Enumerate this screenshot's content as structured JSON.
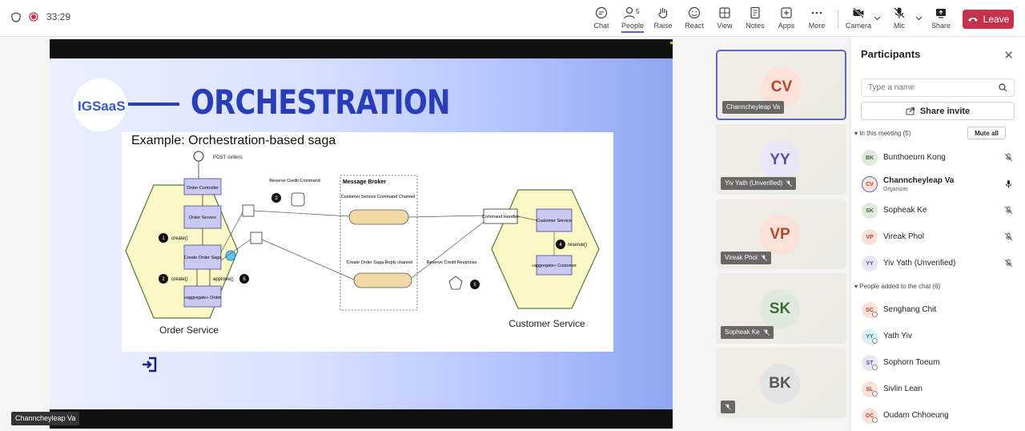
{
  "meeting": {
    "timer": "33:29"
  },
  "toolbar": {
    "chat": "Chat",
    "people": "People",
    "people_count": "5",
    "raise": "Raise",
    "react": "React",
    "view": "View",
    "notes": "Notes",
    "apps": "Apps",
    "more": "More",
    "camera": "Camera",
    "mic": "Mic",
    "share": "Share",
    "leave": "Leave"
  },
  "colors": {
    "accent": "#5b5fc7",
    "leave": "#c4314b",
    "slide_title": "#2a3db8"
  },
  "slide": {
    "logo_text": "IGSaaS",
    "title": "ORCHESTRATION",
    "diagram_title": "Example: Orchestration-based saga",
    "labels": {
      "post_orders": "POST /orders",
      "order_controller": "Order Controller",
      "order_service_box": "Order Service",
      "create_order_saga": "Create Order Saga",
      "order": "«aggregate» Order",
      "create1": "create()",
      "create2": "create()",
      "approve": "approve()",
      "reserve_credit_command": "Reserve Credit Command",
      "message_broker": "Message Broker",
      "customer_service_command_channel": "Customer Service Command Channel",
      "create_order_saga_reply_channel": "Create Order Saga Reply channel",
      "reserve_credit_response": "Reserve Credit Response",
      "command_handler": "Command Handler",
      "customer_service_box": "Customer Service",
      "customer": "«aggregate» Customer",
      "reserve": "reserve()",
      "order_service": "Order Service",
      "customer_service": "Customer Service",
      "n1": "1",
      "n2": "2",
      "n3": "3",
      "n4": "4",
      "n5": "5",
      "n6": "6"
    }
  },
  "stage": {
    "presenter_name": "Channcheyleap Va"
  },
  "video_tiles": [
    {
      "initials": "CV",
      "name": "Channcheyleap Va",
      "muted": false
    },
    {
      "initials": "YY",
      "name": "Yiv Yath (Unverified)",
      "muted": true
    },
    {
      "initials": "VP",
      "name": "Vireak Phol",
      "muted": true
    },
    {
      "initials": "SK",
      "name": "Sopheak Ke",
      "muted": true
    },
    {
      "initials": "BK",
      "name": "",
      "muted": true
    }
  ],
  "panel": {
    "title": "Participants",
    "search_placeholder": "Type a name",
    "share_invite": "Share invite",
    "in_meeting": "In this meeting (5)",
    "mute_all": "Mute all",
    "added_to_chat": "People added to the chat (6)",
    "meeting_people": [
      {
        "initials": "BK",
        "name": "Bunthoeurn Kong",
        "role": "",
        "muted": true
      },
      {
        "initials": "CV",
        "name": "Channcheyleap Va",
        "role": "Organizer",
        "muted": false
      },
      {
        "initials": "SK",
        "name": "Sopheak Ke",
        "role": "",
        "muted": true
      },
      {
        "initials": "VP",
        "name": "Vireak Phol",
        "role": "",
        "muted": true
      },
      {
        "initials": "YY",
        "name": "Yiv Yath (Unverified)",
        "role": "",
        "muted": true
      }
    ],
    "chat_people": [
      {
        "initials": "SC",
        "name": "Senghang Chit"
      },
      {
        "initials": "YY",
        "name": "Yath Yiv"
      },
      {
        "initials": "ST",
        "name": "Sophorn Toeum"
      },
      {
        "initials": "SL",
        "name": "Sivlin Lean"
      },
      {
        "initials": "OC",
        "name": "Oudam Chhoeung"
      }
    ]
  }
}
